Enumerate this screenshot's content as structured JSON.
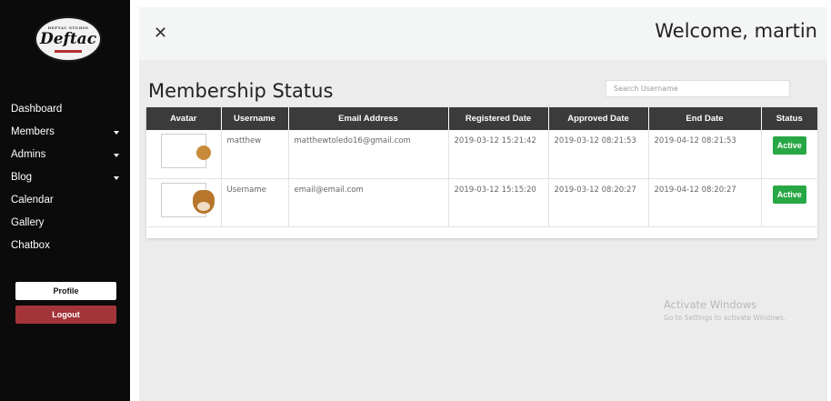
{
  "sidebar": {
    "logo_text": "Deftac",
    "logo_subtext": "DEFTAC STUDIO",
    "items": [
      {
        "label": "Dashboard",
        "has_caret": false
      },
      {
        "label": "Members",
        "has_caret": true
      },
      {
        "label": "Admins",
        "has_caret": true
      },
      {
        "label": "Blog",
        "has_caret": true
      },
      {
        "label": "Calendar",
        "has_caret": false
      },
      {
        "label": "Gallery",
        "has_caret": false
      },
      {
        "label": "Chatbox",
        "has_caret": false
      }
    ],
    "profile_label": "Profile",
    "logout_label": "Logout"
  },
  "header": {
    "close_icon": "close-icon",
    "welcome": "Welcome, martin"
  },
  "main": {
    "title": "Membership Status",
    "search_placeholder": "Search Username",
    "table": {
      "columns": [
        "Avatar",
        "Username",
        "Email Address",
        "Registered Date",
        "Approved Date",
        "End Date",
        "Status"
      ],
      "rows": [
        {
          "username": "matthew",
          "email": "matthewtoledo16@gmail.com",
          "registered": "2019-03-12 15:21:42",
          "approved": "2019-03-12 08:21:53",
          "end": "2019-04-12 08:21:53",
          "status": "Active"
        },
        {
          "username": "Username",
          "email": "email@email.com",
          "registered": "2019-03-12 15:15:20",
          "approved": "2019-03-12 08:20:27",
          "end": "2019-04-12 08:20:27",
          "status": "Active"
        }
      ]
    }
  },
  "watermark": {
    "title": "Activate Windows",
    "subtitle": "Go to Settings to activate Windows."
  },
  "colors": {
    "sidebar_bg": "#0b0b0b",
    "logout_bg": "#a3353a",
    "table_header_bg": "#3b3b3b",
    "status_active": "#28a745",
    "content_bg": "#ececec"
  }
}
